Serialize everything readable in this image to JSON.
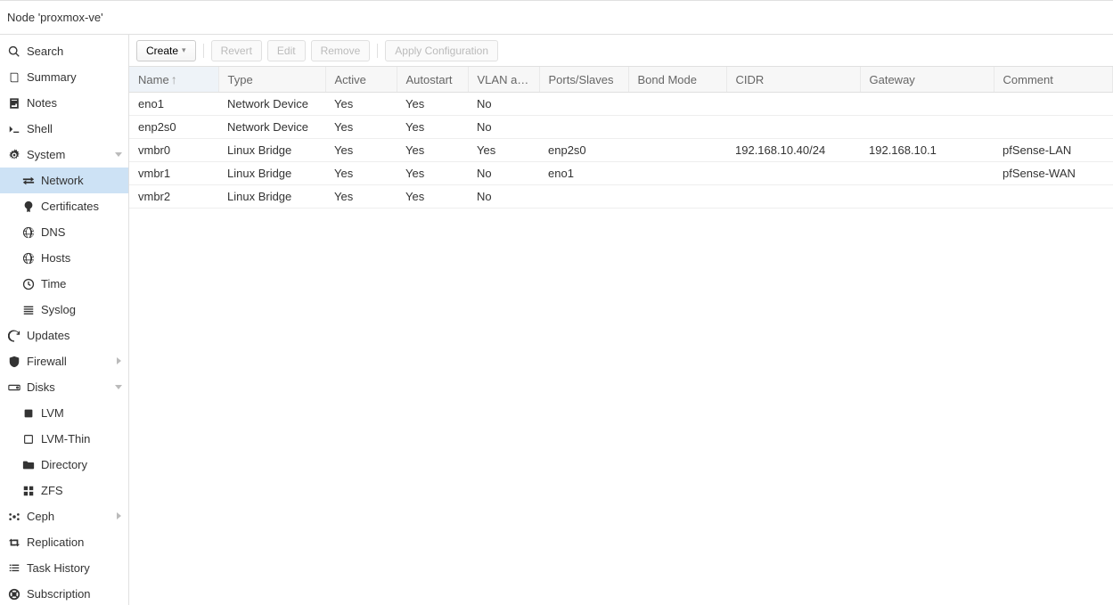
{
  "header": {
    "title": "Node 'proxmox-ve'"
  },
  "sidebar": {
    "items": [
      {
        "label": "Search",
        "icon": "search",
        "indent": false
      },
      {
        "label": "Summary",
        "icon": "book",
        "indent": false
      },
      {
        "label": "Notes",
        "icon": "note",
        "indent": false
      },
      {
        "label": "Shell",
        "icon": "terminal",
        "indent": false
      },
      {
        "label": "System",
        "icon": "cogs",
        "indent": false,
        "expand": "down"
      },
      {
        "label": "Network",
        "icon": "exchange",
        "indent": true,
        "selected": true
      },
      {
        "label": "Certificates",
        "icon": "certificate",
        "indent": true
      },
      {
        "label": "DNS",
        "icon": "globe",
        "indent": true
      },
      {
        "label": "Hosts",
        "icon": "globe",
        "indent": true
      },
      {
        "label": "Time",
        "icon": "clock",
        "indent": true
      },
      {
        "label": "Syslog",
        "icon": "list",
        "indent": true
      },
      {
        "label": "Updates",
        "icon": "refresh",
        "indent": false
      },
      {
        "label": "Firewall",
        "icon": "shield",
        "indent": false,
        "expand": "right"
      },
      {
        "label": "Disks",
        "icon": "hdd",
        "indent": false,
        "expand": "down"
      },
      {
        "label": "LVM",
        "icon": "square-solid",
        "indent": true
      },
      {
        "label": "LVM-Thin",
        "icon": "square",
        "indent": true
      },
      {
        "label": "Directory",
        "icon": "folder",
        "indent": true
      },
      {
        "label": "ZFS",
        "icon": "grid",
        "indent": true
      },
      {
        "label": "Ceph",
        "icon": "ceph",
        "indent": false,
        "expand": "right"
      },
      {
        "label": "Replication",
        "icon": "retweet",
        "indent": false
      },
      {
        "label": "Task History",
        "icon": "tasklist",
        "indent": false
      },
      {
        "label": "Subscription",
        "icon": "support",
        "indent": false
      }
    ]
  },
  "toolbar": {
    "create_label": "Create",
    "revert_label": "Revert",
    "edit_label": "Edit",
    "remove_label": "Remove",
    "apply_label": "Apply Configuration"
  },
  "table": {
    "columns": [
      {
        "label": "Name",
        "sorted": true
      },
      {
        "label": "Type"
      },
      {
        "label": "Active"
      },
      {
        "label": "Autostart"
      },
      {
        "label": "VLAN a…"
      },
      {
        "label": "Ports/Slaves"
      },
      {
        "label": "Bond Mode"
      },
      {
        "label": "CIDR"
      },
      {
        "label": "Gateway"
      },
      {
        "label": "Comment"
      }
    ],
    "rows": [
      {
        "name": "eno1",
        "type": "Network Device",
        "active": "Yes",
        "autostart": "Yes",
        "vlan": "No",
        "ports": "",
        "bond": "",
        "cidr": "",
        "gateway": "",
        "comment": ""
      },
      {
        "name": "enp2s0",
        "type": "Network Device",
        "active": "Yes",
        "autostart": "Yes",
        "vlan": "No",
        "ports": "",
        "bond": "",
        "cidr": "",
        "gateway": "",
        "comment": ""
      },
      {
        "name": "vmbr0",
        "type": "Linux Bridge",
        "active": "Yes",
        "autostart": "Yes",
        "vlan": "Yes",
        "ports": "enp2s0",
        "bond": "",
        "cidr": "192.168.10.40/24",
        "gateway": "192.168.10.1",
        "comment": "pfSense-LAN"
      },
      {
        "name": "vmbr1",
        "type": "Linux Bridge",
        "active": "Yes",
        "autostart": "Yes",
        "vlan": "No",
        "ports": "eno1",
        "bond": "",
        "cidr": "",
        "gateway": "",
        "comment": "pfSense-WAN"
      },
      {
        "name": "vmbr2",
        "type": "Linux Bridge",
        "active": "Yes",
        "autostart": "Yes",
        "vlan": "No",
        "ports": "",
        "bond": "",
        "cidr": "",
        "gateway": "",
        "comment": ""
      }
    ]
  }
}
